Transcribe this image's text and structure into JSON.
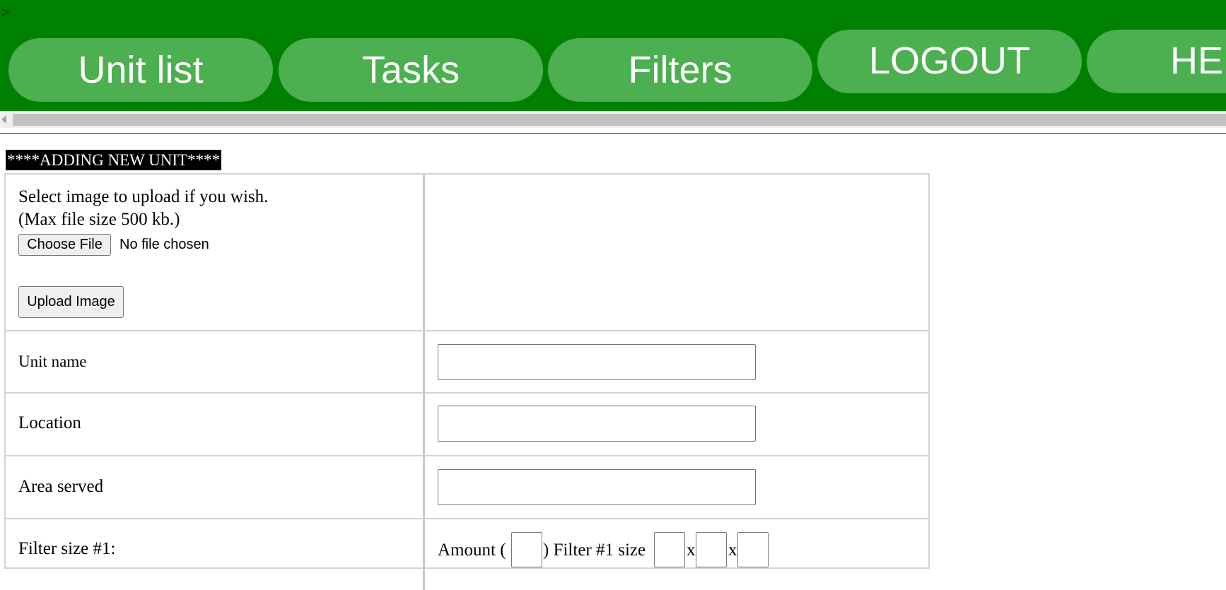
{
  "header": {
    "prompt": ">",
    "nav": [
      {
        "label": "Unit list"
      },
      {
        "label": "Tasks"
      },
      {
        "label": "Filters"
      },
      {
        "label": "LOGOUT"
      },
      {
        "label": "HELP"
      }
    ]
  },
  "page": {
    "heading": "****ADDING NEW UNIT****"
  },
  "upload": {
    "line1": "Select image to upload if you wish.",
    "line2": "(Max file size 500 kb.)",
    "choose_file_label": "Choose File",
    "file_status": "No file chosen",
    "upload_button_label": "Upload Image"
  },
  "fields": {
    "unit_name": {
      "label": "Unit name",
      "value": ""
    },
    "location": {
      "label": "Location",
      "value": ""
    },
    "area_served": {
      "label": "Area served",
      "value": ""
    }
  },
  "filter1": {
    "label": "Filter size #1:",
    "amount_prefix": "Amount (",
    "amount_suffix": ") Filter #1 size",
    "separator": "x"
  },
  "colors": {
    "header_bg": "#008000",
    "nav_button_bg": "#4caf50",
    "heading_bg": "#000000"
  }
}
